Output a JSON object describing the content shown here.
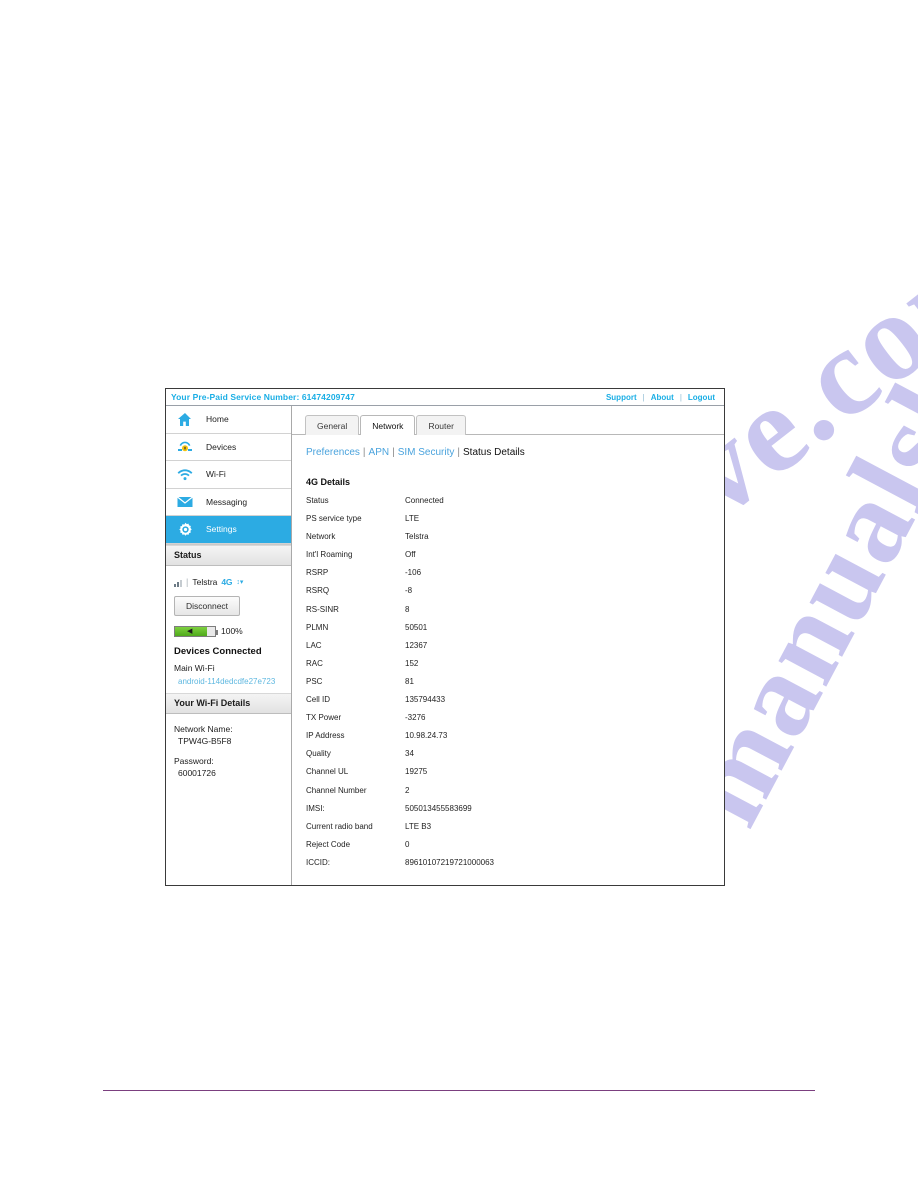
{
  "watermark": {
    "text_a": "ve.com",
    "text_b": "manualshive"
  },
  "topbar": {
    "title": "Your Pre-Paid Service Number: 61474209747",
    "links": [
      {
        "label": "Support",
        "name": "support-link"
      },
      {
        "label": "About",
        "name": "about-link"
      },
      {
        "label": "Logout",
        "name": "logout-link"
      }
    ],
    "separator": "|"
  },
  "sidebar": {
    "nav": [
      {
        "label": "Home",
        "icon": "home-icon",
        "active": false
      },
      {
        "label": "Devices",
        "icon": "devices-icon",
        "active": false
      },
      {
        "label": "Wi-Fi",
        "icon": "wifi-icon",
        "active": false
      },
      {
        "label": "Messaging",
        "icon": "envelope-icon",
        "active": false
      },
      {
        "label": "Settings",
        "icon": "gear-icon",
        "active": true
      }
    ],
    "status": {
      "header": "Status",
      "carrier": "Telstra",
      "network_type": "4G",
      "signal_divider": "|",
      "disconnect_label": "Disconnect",
      "battery_percent": "100%",
      "devices_header": "Devices Connected",
      "main_wifi_label": "Main Wi-Fi",
      "connected_device": "android-114dedcdfe27e723"
    },
    "wifi_details": {
      "header": "Your Wi-Fi Details",
      "network_name_label": "Network Name:",
      "network_name_value": "TPW4G-B5F8",
      "password_label": "Password:",
      "password_value": "60001726"
    }
  },
  "content": {
    "tabs": [
      {
        "label": "General",
        "active": false
      },
      {
        "label": "Network",
        "active": true
      },
      {
        "label": "Router",
        "active": false
      }
    ],
    "subnav": [
      {
        "label": "Preferences",
        "current": false
      },
      {
        "label": "APN",
        "current": false
      },
      {
        "label": "SIM Security",
        "current": false
      },
      {
        "label": "Status Details",
        "current": true
      }
    ],
    "subnav_separator": "|",
    "detail_title": "4G Details",
    "details": [
      {
        "key": "Status",
        "value": "Connected"
      },
      {
        "key": "PS service type",
        "value": "LTE"
      },
      {
        "key": "Network",
        "value": "Telstra"
      },
      {
        "key": "Int'l Roaming",
        "value": "Off"
      },
      {
        "key": "RSRP",
        "value": "-106"
      },
      {
        "key": "RSRQ",
        "value": "-8"
      },
      {
        "key": "RS-SINR",
        "value": "8"
      },
      {
        "key": "PLMN",
        "value": "50501"
      },
      {
        "key": "LAC",
        "value": "12367"
      },
      {
        "key": "RAC",
        "value": "152"
      },
      {
        "key": "PSC",
        "value": "81"
      },
      {
        "key": "Cell ID",
        "value": "135794433"
      },
      {
        "key": "TX Power",
        "value": "-3276"
      },
      {
        "key": "IP Address",
        "value": "10.98.24.73"
      },
      {
        "key": "Quality",
        "value": "34"
      },
      {
        "key": "Channel UL",
        "value": "19275"
      },
      {
        "key": "Channel Number",
        "value": "2"
      },
      {
        "key": "IMSI:",
        "value": "505013455583699"
      },
      {
        "key": "Current radio band",
        "value": "LTE B3"
      },
      {
        "key": "Reject Code",
        "value": "0"
      },
      {
        "key": "ICCID:",
        "value": "89610107219721000063"
      }
    ]
  },
  "colors": {
    "accent_blue": "#2cabe3",
    "link_blue": "#1aaee5",
    "battery_green": "#4faa1b",
    "rule_purple": "#7b3f7f"
  }
}
